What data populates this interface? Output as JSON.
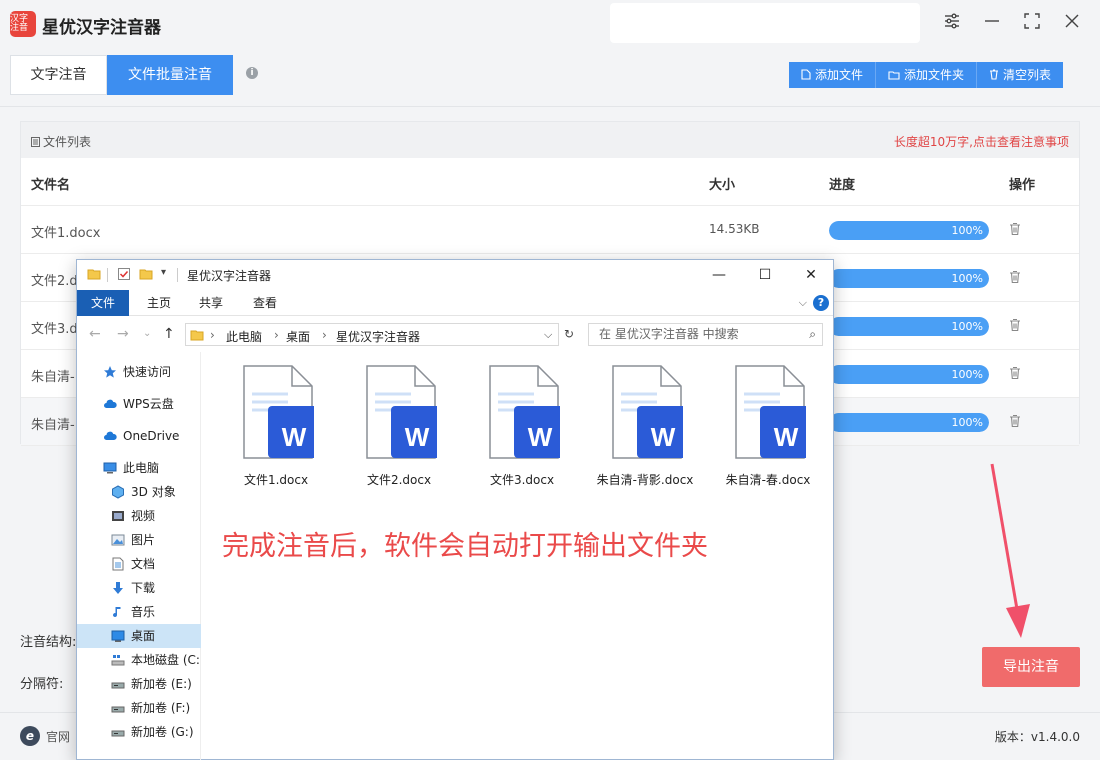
{
  "app": {
    "title": "星优汉字注音器",
    "logo_text": "汉字注音"
  },
  "tabs": [
    {
      "label": "文字注音",
      "active": false
    },
    {
      "label": "文件批量注音",
      "active": true
    }
  ],
  "toolbar": {
    "add_file": "添加文件",
    "add_folder": "添加文件夹",
    "clear_list": "清空列表"
  },
  "file_list": {
    "title": "文件列表",
    "warning": "长度超10万字,点击查看注意事项",
    "columns": {
      "name": "文件名",
      "size": "大小",
      "progress": "进度",
      "action": "操作"
    },
    "rows": [
      {
        "name": "文件1.docx",
        "size": "14.53KB",
        "progress_pct": 100,
        "progress_label": "100%"
      },
      {
        "name": "文件2.d",
        "size": "",
        "progress_pct": 100,
        "progress_label": "100%"
      },
      {
        "name": "文件3.d",
        "size": "",
        "progress_pct": 100,
        "progress_label": "100%"
      },
      {
        "name": "朱自清-",
        "size": "",
        "progress_pct": 100,
        "progress_label": "100%"
      },
      {
        "name": "朱自清-",
        "size": "",
        "progress_pct": 100,
        "progress_label": "100%"
      }
    ]
  },
  "settings": {
    "structure_label": "注音结构:",
    "separator_label": "分隔符:"
  },
  "export_button": "导出注音",
  "footer": {
    "site": "官网",
    "version": "版本：v1.4.0.0"
  },
  "explorer": {
    "title": "星优汉字注音器",
    "ribbon_tabs": [
      "文件",
      "主页",
      "共享",
      "查看"
    ],
    "breadcrumb": [
      "此电脑",
      "桌面",
      "星优汉字注音器"
    ],
    "search_placeholder": "在 星优汉字注音器 中搜索",
    "sidebar": [
      {
        "label": "快速访问",
        "icon": "star-icon",
        "indent": 1
      },
      {
        "label": "WPS云盘",
        "icon": "cloud-icon",
        "indent": 1
      },
      {
        "label": "OneDrive",
        "icon": "cloud-icon",
        "indent": 1
      },
      {
        "label": "此电脑",
        "icon": "computer-icon",
        "indent": 1
      },
      {
        "label": "3D 对象",
        "icon": "cube-icon",
        "indent": 2
      },
      {
        "label": "视频",
        "icon": "video-icon",
        "indent": 2
      },
      {
        "label": "图片",
        "icon": "picture-icon",
        "indent": 2
      },
      {
        "label": "文档",
        "icon": "document-icon",
        "indent": 2
      },
      {
        "label": "下载",
        "icon": "download-icon",
        "indent": 2
      },
      {
        "label": "音乐",
        "icon": "music-icon",
        "indent": 2
      },
      {
        "label": "桌面",
        "icon": "desktop-icon",
        "indent": 2,
        "selected": true
      },
      {
        "label": "本地磁盘 (C:",
        "icon": "disk-icon",
        "indent": 2
      },
      {
        "label": "新加卷 (E:)",
        "icon": "drive-icon",
        "indent": 2
      },
      {
        "label": "新加卷 (F:)",
        "icon": "drive-icon",
        "indent": 2
      },
      {
        "label": "新加卷 (G:)",
        "icon": "drive-icon",
        "indent": 2
      }
    ],
    "files": [
      {
        "name": "文件1.docx",
        "icon_letter": "W"
      },
      {
        "name": "文件2.docx",
        "icon_letter": "W"
      },
      {
        "name": "文件3.docx",
        "icon_letter": "W"
      },
      {
        "name": "朱自清-背影.docx",
        "icon_letter": "W"
      },
      {
        "name": "朱自清-春.docx",
        "icon_letter": "W"
      }
    ],
    "overlay_text": "完成注音后，软件会自动打开输出文件夹"
  },
  "colors": {
    "accent": "#3d8ef0",
    "export": "#f06b6b",
    "warning": "#e04545",
    "word_blue": "#2b5bd7",
    "overlay_red": "#ea4a4a"
  }
}
